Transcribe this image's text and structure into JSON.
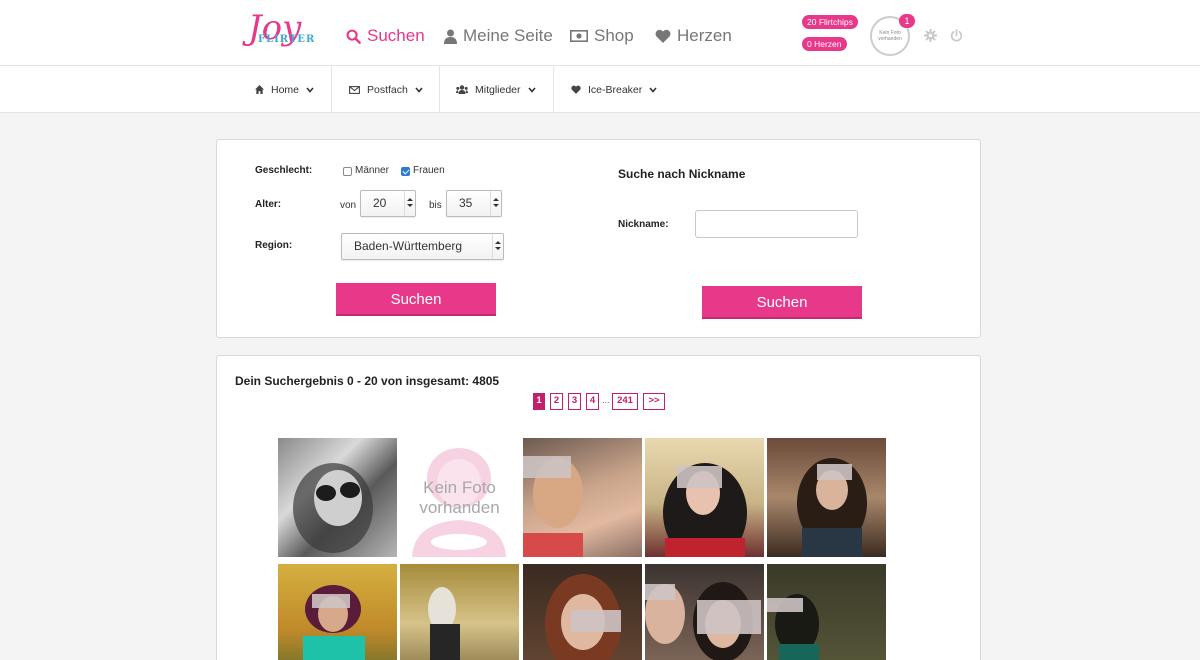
{
  "header": {
    "logo_main": "Joy",
    "logo_sub": "FLIRTER",
    "nav": [
      {
        "label": "Suchen",
        "icon": "search-icon"
      },
      {
        "label": "Meine Seite",
        "icon": "user-icon"
      },
      {
        "label": "Shop",
        "icon": "money-icon"
      },
      {
        "label": "Herzen",
        "icon": "heart-icon"
      }
    ],
    "flirtchips": "20 Flirtchips",
    "herzen_count": "0 Herzen",
    "avatar_text": "Kein Foto vorhanden",
    "notification_count": "1",
    "accent": "#e8388a"
  },
  "subnav": [
    {
      "label": "Home",
      "icon": "home-icon"
    },
    {
      "label": "Postfach",
      "icon": "envelope-icon"
    },
    {
      "label": "Mitglieder",
      "icon": "users-icon"
    },
    {
      "label": "Ice-Breaker",
      "icon": "heart-icon"
    }
  ],
  "search": {
    "gender_label": "Geschlecht:",
    "men_label": "Männer",
    "women_label": "Frauen",
    "men_checked": false,
    "women_checked": true,
    "age_label": "Alter:",
    "from_label": "von",
    "from_value": "20",
    "to_label": "bis",
    "to_value": "35",
    "region_label": "Region:",
    "region_value": "Baden-Württemberg",
    "button_label": "Suchen"
  },
  "nickname_search": {
    "title": "Suche nach Nickname",
    "label": "Nickname:",
    "value": "",
    "button_label": "Suchen"
  },
  "results": {
    "title": "Dein Suchergebnis 0 - 20 von insgesamt: 4805",
    "pages": [
      "1",
      "2",
      "3",
      "4"
    ],
    "dots": "...",
    "last_page": "241",
    "next": ">>",
    "current_page": "1",
    "no_photo_line1": "Kein Foto",
    "no_photo_line2": "vorhanden"
  }
}
